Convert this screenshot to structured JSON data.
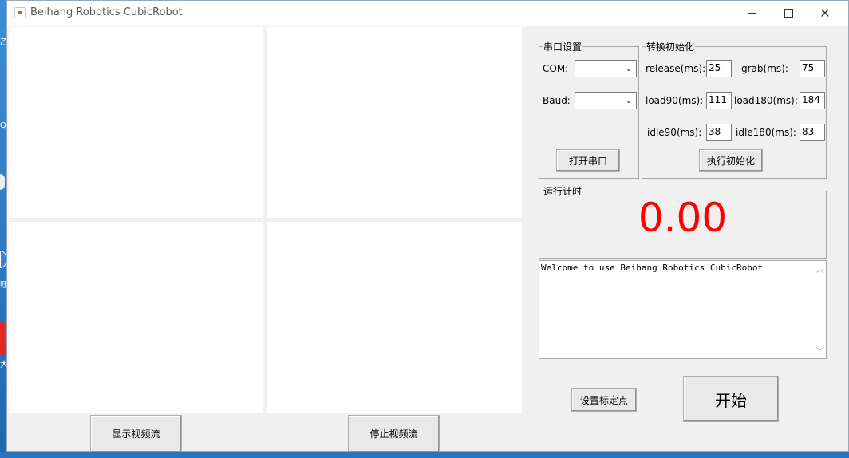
{
  "window": {
    "title": "Beihang Robotics CubicRobot"
  },
  "controls": {
    "show_video_label": "显示视频流",
    "stop_video_label": "停止视频流",
    "set_calibration_label": "设置标定点",
    "start_label": "开始"
  },
  "serial": {
    "group_title": "串口设置",
    "com_label": "COM:",
    "com_value": "",
    "baud_label": "Baud:",
    "baud_value": "",
    "open_label": "打开串口"
  },
  "init": {
    "group_title": "转换初始化",
    "release_label": "release(ms):",
    "release_value": "25",
    "grab_label": "grab(ms):",
    "grab_value": "75",
    "load90_label": "load90(ms):",
    "load90_value": "111",
    "load180_label": "load180(ms):",
    "load180_value": "184",
    "idle90_label": "idle90(ms):",
    "idle90_value": "38",
    "idle180_label": "idle180(ms):",
    "idle180_value": "83",
    "exec_label": "执行初始化"
  },
  "timer": {
    "group_title": "运行计时",
    "value": "0.00",
    "color": "#ff0000"
  },
  "log": {
    "text": "Welcome to use Beihang Robotics CubicRobot"
  },
  "icons": {
    "minimize": "minimize-icon",
    "maximize": "maximize-icon",
    "close": "close-icon",
    "dropdown": "chevron-down-icon"
  }
}
